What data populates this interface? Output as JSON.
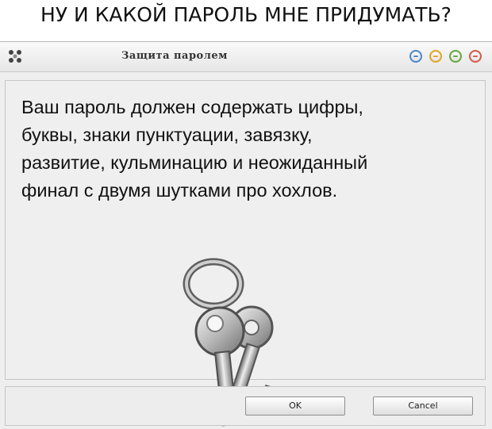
{
  "meme": {
    "caption": "НУ И КАКОЙ ПАРОЛЬ МНЕ ПРИДУМАТЬ?"
  },
  "window": {
    "title": "Защита паролем",
    "controls": [
      {
        "name": "blue",
        "color": "#4d86c7"
      },
      {
        "name": "yellow",
        "color": "#e0a623"
      },
      {
        "name": "green",
        "color": "#66a83b"
      },
      {
        "name": "red",
        "color": "#d65a4a"
      }
    ],
    "icon": "app-icon"
  },
  "message": {
    "lines": [
      "Ваш пароль должен содержать цифры,",
      "буквы, знаки пунктуации, завязку,",
      "развитие, кульминацию и неожиданный",
      "финал с двумя шутками про хохлов."
    ]
  },
  "illustration": {
    "icon": "keys-icon"
  },
  "buttons": {
    "ok_label": "OK",
    "cancel_label": "Cancel"
  }
}
